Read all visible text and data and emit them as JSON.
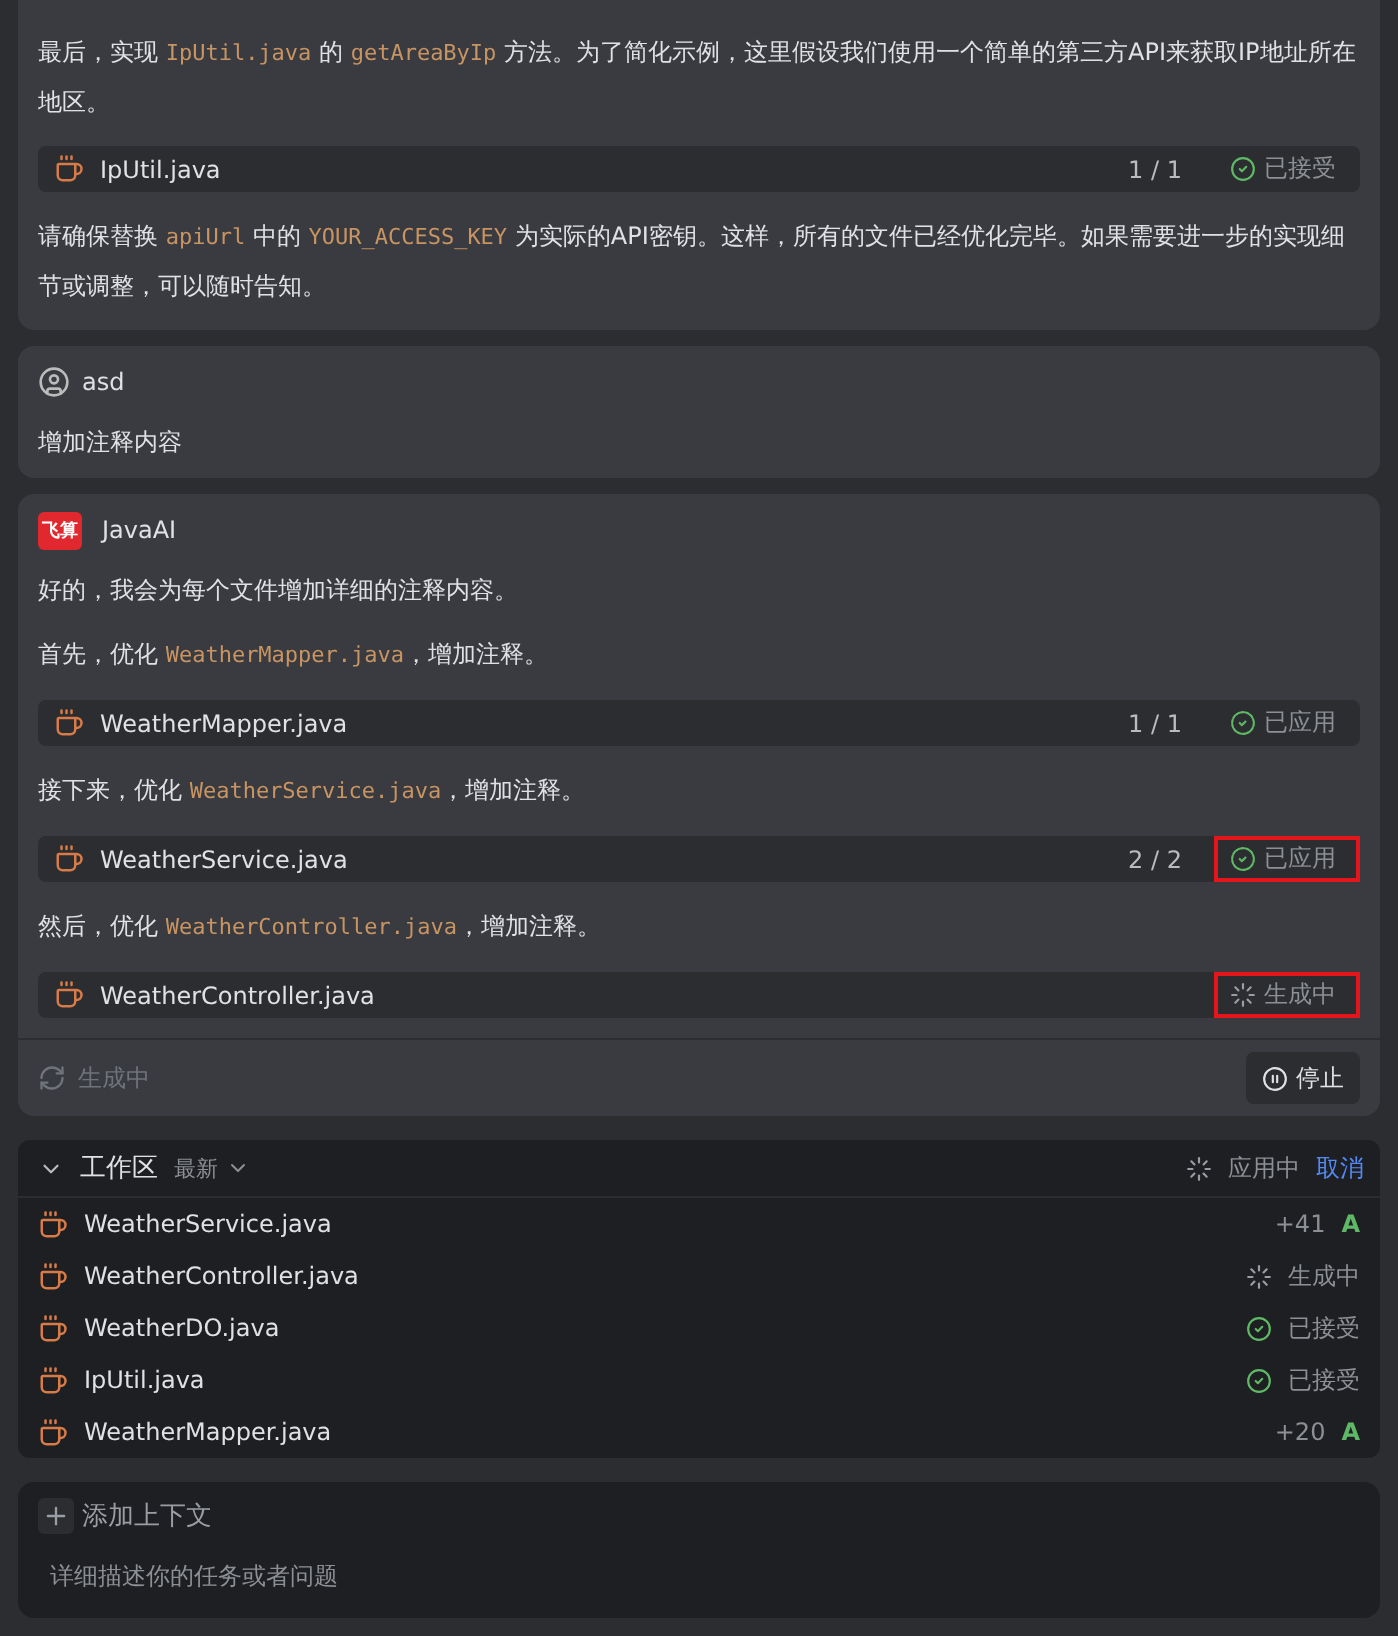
{
  "messages": [
    {
      "blocks": [
        {
          "kind": "text",
          "parts": [
            {
              "text": "最后，实现 ",
              "code": false
            },
            {
              "text": "IpUtil.java",
              "code": true
            },
            {
              "text": " 的 ",
              "code": false
            },
            {
              "text": "getAreaByIp",
              "code": true
            },
            {
              "text": " 方法。为了简化示例，这里假设我们使用一个简单的第三方API来获取IP地址所在地区。",
              "code": false
            }
          ]
        },
        {
          "kind": "file",
          "name": "IpUtil.java",
          "count": "1 / 1",
          "status": {
            "kind": "accepted",
            "text": "已接受"
          },
          "highlighted": false
        },
        {
          "kind": "text",
          "parts": [
            {
              "text": "请确保替换 ",
              "code": false
            },
            {
              "text": "apiUrl",
              "code": true
            },
            {
              "text": " 中的 ",
              "code": false
            },
            {
              "text": "YOUR_ACCESS_KEY",
              "code": true
            },
            {
              "text": " 为实际的API密钥。这样，所有的文件已经优化完毕。如果需要进一步的实现细节或调整，可以随时告知。",
              "code": false
            }
          ]
        }
      ]
    },
    {
      "kind": "user",
      "author": "asd",
      "blocks": [
        {
          "kind": "text",
          "parts": [
            {
              "text": "增加注释内容",
              "code": false
            }
          ]
        }
      ]
    },
    {
      "kind": "assistant",
      "author": "JavaAI",
      "logo_text": "飞算",
      "blocks": [
        {
          "kind": "text",
          "parts": [
            {
              "text": "好的，我会为每个文件增加详细的注释内容。",
              "code": false
            }
          ]
        },
        {
          "kind": "text",
          "parts": [
            {
              "text": "首先，优化 ",
              "code": false
            },
            {
              "text": "WeatherMapper.java",
              "code": true
            },
            {
              "text": "，增加注释。",
              "code": false
            }
          ]
        },
        {
          "kind": "file",
          "name": "WeatherMapper.java",
          "count": "1 / 1",
          "status": {
            "kind": "applied",
            "text": "已应用"
          },
          "highlighted": false
        },
        {
          "kind": "text",
          "parts": [
            {
              "text": "接下来，优化 ",
              "code": false
            },
            {
              "text": "WeatherService.java",
              "code": true
            },
            {
              "text": "，增加注释。",
              "code": false
            }
          ]
        },
        {
          "kind": "file",
          "name": "WeatherService.java",
          "count": "2 / 2",
          "status": {
            "kind": "applied",
            "text": "已应用"
          },
          "highlighted": true
        },
        {
          "kind": "text",
          "parts": [
            {
              "text": "然后，优化 ",
              "code": false
            },
            {
              "text": "WeatherController.java",
              "code": true
            },
            {
              "text": "，增加注释。",
              "code": false
            }
          ]
        },
        {
          "kind": "file",
          "name": "WeatherController.java",
          "status": {
            "kind": "generating",
            "text": "生成中"
          },
          "highlighted": true
        }
      ],
      "footer": {
        "status": "生成中",
        "stop_button": "停止"
      }
    }
  ],
  "workspace": {
    "expanded": true,
    "title": "工作区",
    "sort": "最新",
    "status": "应用中",
    "cancel": "取消",
    "files": [
      {
        "name": "WeatherService.java",
        "kind": "added",
        "lines": "+41",
        "badge": "A"
      },
      {
        "name": "WeatherController.java",
        "kind": "generating",
        "text": "生成中"
      },
      {
        "name": "WeatherDO.java",
        "kind": "accepted",
        "text": "已接受"
      },
      {
        "name": "IpUtil.java",
        "kind": "accepted",
        "text": "已接受"
      },
      {
        "name": "WeatherMapper.java",
        "kind": "added",
        "lines": "+20",
        "badge": "A"
      }
    ]
  },
  "composer": {
    "add_context": "添加上下文",
    "placeholder": "详细描述你的任务或者问题"
  }
}
